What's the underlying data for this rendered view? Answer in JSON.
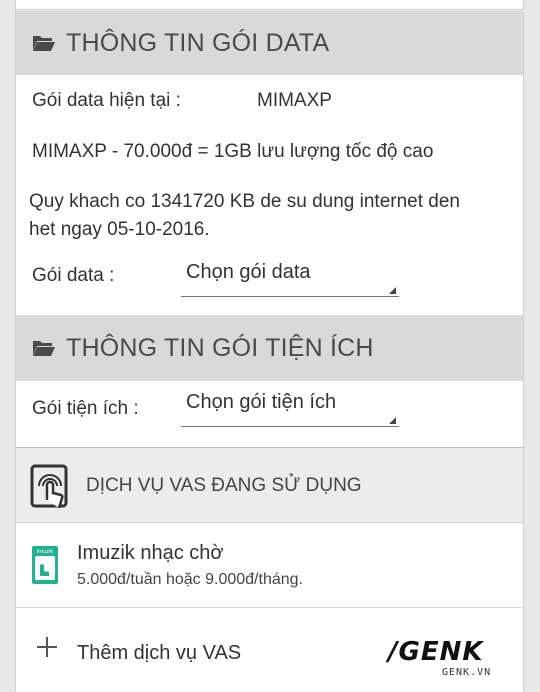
{
  "data_section": {
    "title": "THÔNG TIN GÓI DATA",
    "icon": "folder-open-icon",
    "current_package_label": "Gói data hiện tại :",
    "current_package_value": "MIMAXP",
    "package_desc": "MIMAXP - 70.000đ = 1GB lưu lượng tốc độ cao",
    "balance_line1": "Quy khach co 1341720 KB de su dung internet den",
    "balance_line2": "het ngay 05-10-2016.",
    "select_label": "Gói data :",
    "select_value": "Chọn gói data"
  },
  "utility_section": {
    "title": "THÔNG TIN GÓI TIỆN ÍCH",
    "icon": "folder-open-icon",
    "select_label": "Gói tiện ích :",
    "select_value": "Chọn gói tiện ích"
  },
  "vas_section": {
    "title": "DỊCH VỤ VAS ĐANG SỬ DỤNG",
    "icon": "touch-hand-icon",
    "items": [
      {
        "icon": "imuzik-app-icon",
        "icon_text": "Imuzik",
        "name": "Imuzik nhạc chờ",
        "price": "5.000đ/tuần hoặc 9.000đ/tháng."
      }
    ],
    "add_label": "Thêm dịch vụ VAS",
    "add_icon": "plus-icon"
  },
  "watermark": {
    "main": "/GENK",
    "sub": "GENK.VN"
  },
  "colors": {
    "header_bg": "#d9d9d9",
    "vas_header_bg": "#ececec",
    "imuzik_green": "#25b08f"
  }
}
